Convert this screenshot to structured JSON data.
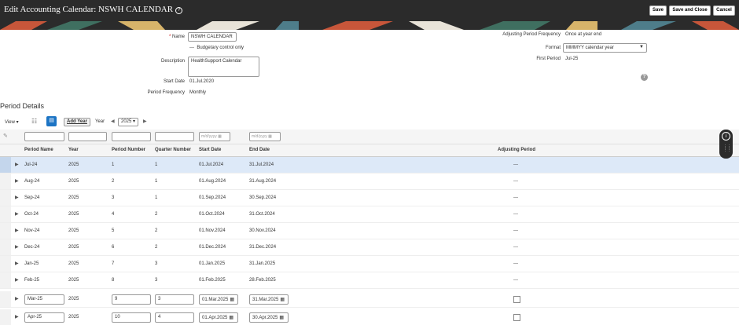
{
  "header": {
    "title": "Edit Accounting Calendar: NSWH CALENDAR",
    "help_glyph": "?",
    "save": "Save",
    "save_close": "Save and Close",
    "cancel": "Cancel"
  },
  "form": {
    "name_required": "*",
    "name_label": "Name",
    "name_value": "NSWH CALENDAR",
    "budgetary_mark": "---",
    "budgetary_label": "Budgetary control only",
    "description_label": "Description",
    "description_value": "HealthSupport Calendar",
    "start_date_label": "Start Date",
    "start_date_value": "01.Jul.2020",
    "period_frequency_label": "Period Frequency",
    "period_frequency_value": "Monthly",
    "adjusting_freq_label": "Adjusting Period Frequency",
    "adjusting_freq_value": "Once at year end",
    "format_label": "Format",
    "format_value": "MMMYY calendar year",
    "first_period_label": "First Period",
    "first_period_value": "Jul-25"
  },
  "period_details": {
    "title": "Period Details",
    "view_label": "View",
    "add_year_label": "Add Year",
    "year_label": "Year",
    "year_value": "2025",
    "filter_date_placeholder": "m/d/yyyy",
    "columns": [
      "Period Name",
      "Year",
      "Period Number",
      "Quarter Number",
      "Start Date",
      "End Date",
      "Adjusting Period"
    ],
    "rows": [
      {
        "name": "Jul-24",
        "year": "2025",
        "num": "1",
        "q": "1",
        "start": "01.Jul.2024",
        "end": "31.Jul.2024",
        "adj": "---"
      },
      {
        "name": "Aug-24",
        "year": "2025",
        "num": "2",
        "q": "1",
        "start": "01.Aug.2024",
        "end": "31.Aug.2024",
        "adj": "---"
      },
      {
        "name": "Sep-24",
        "year": "2025",
        "num": "3",
        "q": "1",
        "start": "01.Sep.2024",
        "end": "30.Sep.2024",
        "adj": "---"
      },
      {
        "name": "Oct-24",
        "year": "2025",
        "num": "4",
        "q": "2",
        "start": "01.Oct.2024",
        "end": "31.Oct.2024",
        "adj": "---"
      },
      {
        "name": "Nov-24",
        "year": "2025",
        "num": "5",
        "q": "2",
        "start": "01.Nov.2024",
        "end": "30.Nov.2024",
        "adj": "---"
      },
      {
        "name": "Dec-24",
        "year": "2025",
        "num": "6",
        "q": "2",
        "start": "01.Dec.2024",
        "end": "31.Dec.2024",
        "adj": "---"
      },
      {
        "name": "Jan-25",
        "year": "2025",
        "num": "7",
        "q": "3",
        "start": "01.Jan.2025",
        "end": "31.Jan.2025",
        "adj": "---"
      },
      {
        "name": "Feb-25",
        "year": "2025",
        "num": "8",
        "q": "3",
        "start": "01.Feb.2025",
        "end": "28.Feb.2025",
        "adj": "---"
      },
      {
        "name": "Mar-25",
        "year": "2025",
        "num": "9",
        "q": "3",
        "start": "01.Mar.2025",
        "end": "31.Mar.2025",
        "adj": ""
      },
      {
        "name": "Apr-25",
        "year": "2025",
        "num": "10",
        "q": "4",
        "start": "01.Apr.2025",
        "end": "30.Apr.2025",
        "adj": ""
      }
    ]
  },
  "colors": {
    "header_bg": "#2b2b2b",
    "selected_row": "#dde9f8",
    "accent_blue": "#1c74c4"
  }
}
